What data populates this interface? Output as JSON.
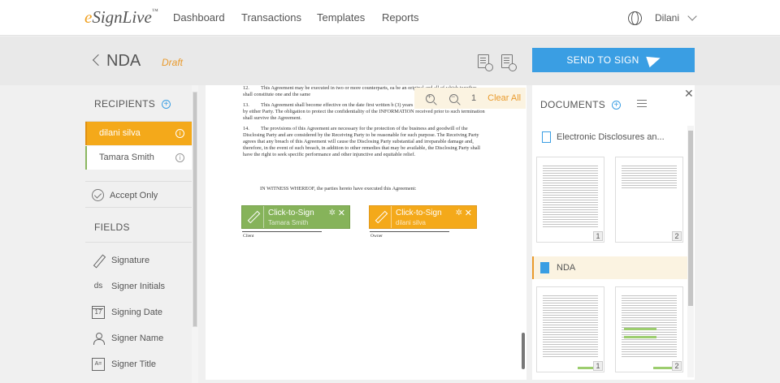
{
  "nav": {
    "logo": "eSignLive",
    "links": [
      "Dashboard",
      "Transactions",
      "Templates",
      "Reports"
    ],
    "username": "Dilani"
  },
  "header": {
    "title": "NDA",
    "status": "Draft",
    "send_label": "SEND TO SIGN"
  },
  "left": {
    "recipients_title": "RECIPIENTS",
    "recipients": [
      "dilani silva",
      "Tamara Smith"
    ],
    "accept_only": "Accept Only",
    "fields_title": "FIELDS",
    "fields": [
      {
        "label": "Signature",
        "icon": "pen-icon"
      },
      {
        "label": "Signer Initials",
        "icon": "ds"
      },
      {
        "label": "Signing Date",
        "icon": "17"
      },
      {
        "label": "Signer Name",
        "icon": "person-icon"
      },
      {
        "label": "Signer Title",
        "icon": "A="
      }
    ]
  },
  "document": {
    "paragraphs": [
      {
        "num": "12.",
        "text": "This Agreement may be executed in two or more counterparts, ea be an original and all of which together shall constitute one and the same"
      },
      {
        "num": "13.",
        "text": "This Agreement shall become effective on the date first written b (3) years unless terminated earlier in writing by either Party. The obligation to protect the confidentiality of the INFORMATION received prior to such termination shall survive the Agreement."
      },
      {
        "num": "14.",
        "text": "The provisions of this Agreement are necessary for the protection of the business and goodwill of the Disclosing Party and are considered by the Receiving Party to be reasonable for such purpose. The Receiving Party agrees that any breach of this Agreement will cause the Disclosing Party substantial and irreparable damage and, therefore, in the event of such breach, in addition to other remedies that may be available, the Disclosing Party shall have the right to seek specific performance and other injunctive and equitable relief."
      }
    ],
    "witness": "IN WITNESS WHEREOF, the parties hereto have executed this Agreement:",
    "sig_client": {
      "label": "Click-to-Sign",
      "name": "Tamara Smith",
      "line_label": "Client"
    },
    "sig_owner": {
      "label": "Click-to-Sign",
      "name": "dilani silva",
      "line_label": "Owner"
    }
  },
  "zoom": {
    "page": "1",
    "clear_all": "Clear All"
  },
  "documents": {
    "title": "DOCUMENTS",
    "items": [
      {
        "name": "Electronic Disclosures an...",
        "pages": [
          "1",
          "2"
        ]
      },
      {
        "name": "NDA",
        "pages": [
          "1",
          "2"
        ]
      }
    ]
  },
  "colors": {
    "accent_blue": "#3a9ee3",
    "orange": "#f4a91a",
    "green": "#86b35a"
  }
}
